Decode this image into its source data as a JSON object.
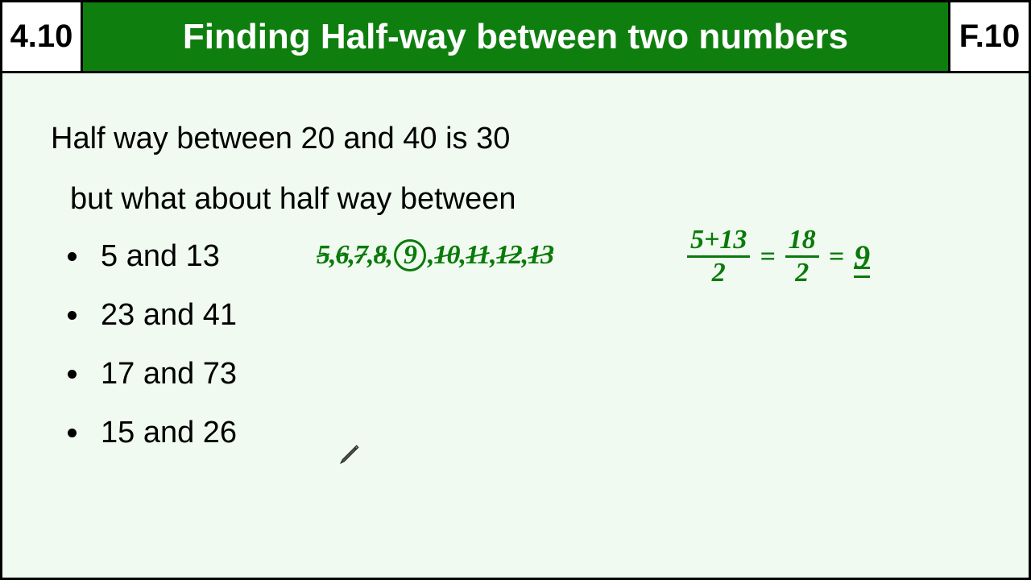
{
  "header": {
    "left_code": "4.10",
    "title": "Finding Half-way between two numbers",
    "right_code": "F.10"
  },
  "content": {
    "line1": "Half way between 20 and 40 is 30",
    "line2": "but what about half way between",
    "bullets": [
      "5 and 13",
      "23 and 41",
      "17 and 73",
      "15 and 26"
    ]
  },
  "handwriting": {
    "sequence": [
      "5",
      "6",
      "7",
      "8",
      "9",
      "10",
      "11",
      "12",
      "13"
    ],
    "sequence_circled_index": 4,
    "equation": {
      "frac1_num": "5+13",
      "frac1_den": "2",
      "frac2_num": "18",
      "frac2_den": "2",
      "result": "9"
    },
    "eq_sign": "="
  },
  "colors": {
    "header_green": "#0e7f0e",
    "ink_green": "#0a7a0a",
    "page_bg": "#f0faf0"
  }
}
